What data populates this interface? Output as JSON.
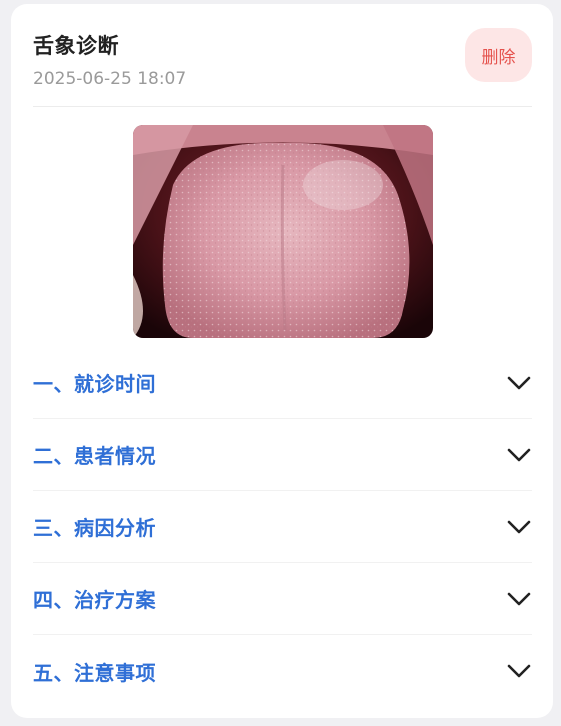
{
  "record": {
    "title": "舌象诊断",
    "timestamp": "2025-06-25 18:07",
    "delete_label": "删除",
    "image_icon": "tongue-photo"
  },
  "sections": [
    {
      "label": "一、就诊时间",
      "icon": "chevron-down-icon"
    },
    {
      "label": "二、患者情况",
      "icon": "chevron-down-icon"
    },
    {
      "label": "三、病因分析",
      "icon": "chevron-down-icon"
    },
    {
      "label": "四、治疗方案",
      "icon": "chevron-down-icon"
    },
    {
      "label": "五、注意事项",
      "icon": "chevron-down-icon"
    }
  ],
  "colors": {
    "accent": "#2f6fd6",
    "danger": "#e5524d",
    "danger_bg": "#fde6e6"
  }
}
